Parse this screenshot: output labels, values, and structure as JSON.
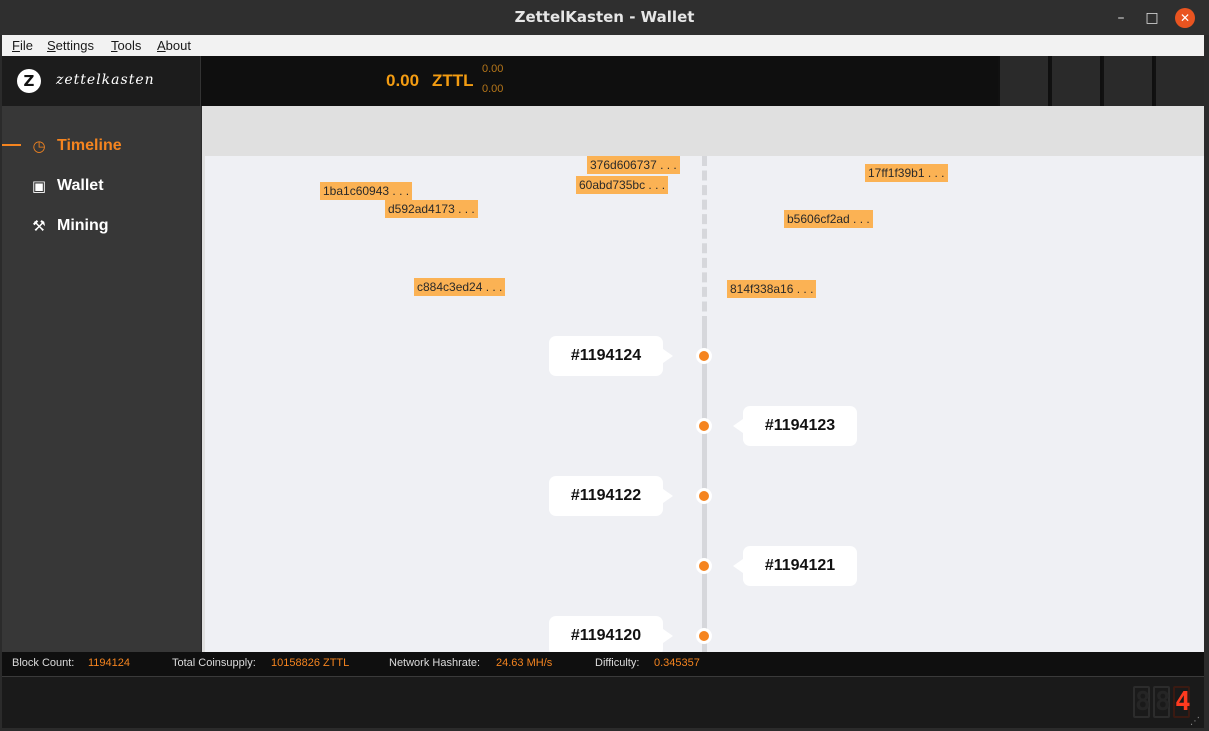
{
  "window": {
    "title": "ZettelKasten - Wallet",
    "minimize": "–",
    "maximize": "□",
    "close": "✕"
  },
  "menu": [
    "File",
    "Settings",
    "Tools",
    "About"
  ],
  "header": {
    "logo_letter": "Z",
    "logo_text": "zettelkasten",
    "balance": "0.00",
    "unit": "ZTTL",
    "sub_balance_1": "0.00",
    "sub_balance_2": "0.00"
  },
  "sidebar": {
    "items": [
      {
        "label": "Timeline",
        "icon": "clock-icon",
        "glyph": "◷",
        "active": true
      },
      {
        "label": "Wallet",
        "icon": "wallet-icon",
        "glyph": "▣",
        "active": false
      },
      {
        "label": "Mining",
        "icon": "tools-icon",
        "glyph": "⚒",
        "active": false
      }
    ]
  },
  "timeline": {
    "transactions": [
      "376d606737 . . .",
      "60abd735bc . . .",
      "17ff1f39b1 . . .",
      "1ba1c60943 . . .",
      "d592ad4173 . . .",
      "b5606cf2ad . . .",
      "c884c3ed24 . . .",
      "814f338a16 . . ."
    ],
    "blocks": [
      "#1194124",
      "#1194123",
      "#1194122",
      "#1194121",
      "#1194120"
    ]
  },
  "status": {
    "block_count_label": "Block Count:",
    "block_count": "1194124",
    "coinsupply_label": "Total Coinsupply:",
    "coinsupply": "10158826 ZTTL",
    "hashrate_label": "Network Hashrate:",
    "hashrate": "24.63 MH/s",
    "difficulty_label": "Difficulty:",
    "difficulty": "0.345357"
  },
  "display": {
    "digits": [
      "8",
      "8",
      "4"
    ]
  },
  "colors": {
    "accent": "#f5841f",
    "tx_tag": "#fbb254",
    "dark": "#0f0f0f"
  }
}
